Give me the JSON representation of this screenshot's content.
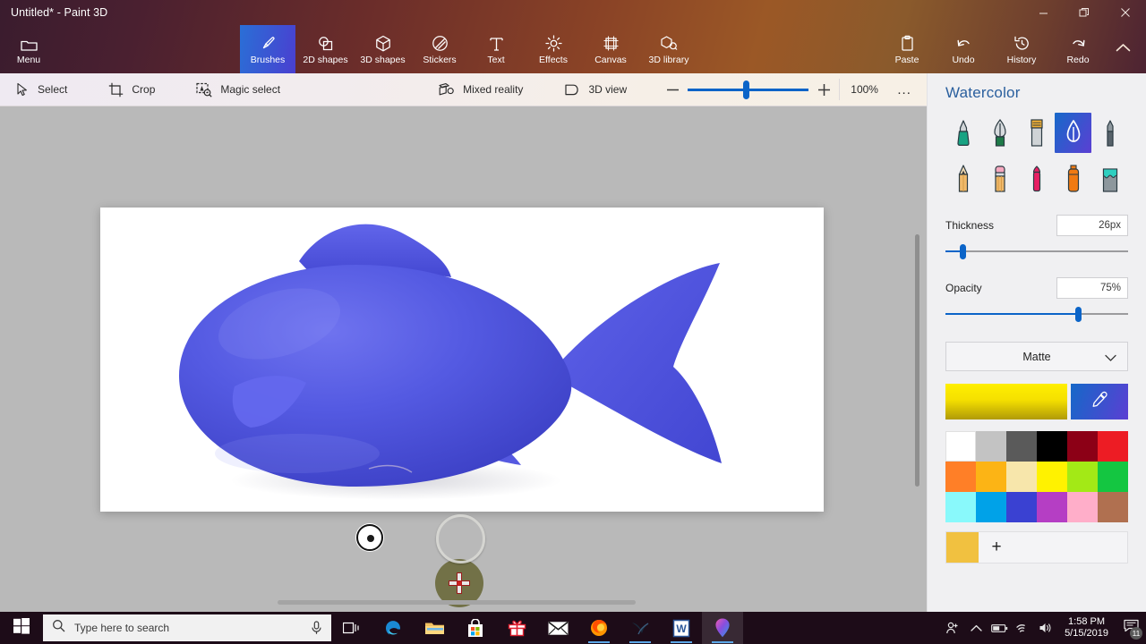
{
  "window": {
    "title": "Untitled* - Paint 3D",
    "minimize_label": "Minimize",
    "restore_label": "Restore",
    "close_label": "Close"
  },
  "ribbon": {
    "menu": {
      "label": "Menu",
      "icon": "folder-icon"
    },
    "tools": [
      {
        "label": "Brushes",
        "icon": "brush-icon",
        "active": true
      },
      {
        "label": "2D shapes",
        "icon": "2d-shapes-icon",
        "active": false
      },
      {
        "label": "3D shapes",
        "icon": "3d-shapes-icon",
        "active": false
      },
      {
        "label": "Stickers",
        "icon": "stickers-icon",
        "active": false
      },
      {
        "label": "Text",
        "icon": "text-icon",
        "active": false
      },
      {
        "label": "Effects",
        "icon": "effects-icon",
        "active": false
      },
      {
        "label": "Canvas",
        "icon": "canvas-icon",
        "active": false
      },
      {
        "label": "3D library",
        "icon": "3d-library-icon",
        "active": false
      }
    ],
    "right_tools": [
      {
        "label": "Paste",
        "icon": "clipboard-icon"
      },
      {
        "label": "Undo",
        "icon": "undo-icon"
      },
      {
        "label": "History",
        "icon": "history-icon"
      },
      {
        "label": "Redo",
        "icon": "redo-icon"
      }
    ],
    "collapse_icon": "chevron-up-icon"
  },
  "toolbar": {
    "select": {
      "label": "Select",
      "icon": "cursor-icon"
    },
    "crop": {
      "label": "Crop",
      "icon": "crop-icon"
    },
    "magic_select": {
      "label": "Magic select",
      "icon": "magic-select-icon"
    },
    "mixed_reality": {
      "label": "Mixed reality",
      "icon": "mixed-reality-icon"
    },
    "view_3d": {
      "label": "3D view",
      "icon": "3d-view-icon"
    },
    "zoom_out_label": "Zoom out",
    "zoom_in_label": "Zoom in",
    "zoom_value": "100%",
    "more_label": "..."
  },
  "sidebar": {
    "title": "Watercolor",
    "brushes": [
      {
        "name": "marker",
        "selected": false
      },
      {
        "name": "calligraphy-pen",
        "selected": false
      },
      {
        "name": "oil-brush",
        "selected": false
      },
      {
        "name": "watercolor",
        "selected": true
      },
      {
        "name": "pixel-pen",
        "selected": false
      },
      {
        "name": "pencil",
        "selected": false
      },
      {
        "name": "eraser",
        "selected": false
      },
      {
        "name": "crayon",
        "selected": false
      },
      {
        "name": "spray-can",
        "selected": false
      },
      {
        "name": "fill",
        "selected": false
      }
    ],
    "thickness": {
      "label": "Thickness",
      "value": "26px",
      "percent": 10
    },
    "opacity": {
      "label": "Opacity",
      "value": "75%",
      "percent": 75
    },
    "material": {
      "value": "Matte",
      "icon": "chevron-down-icon"
    },
    "current_color": "#f5e000",
    "eyedropper_label": "Pick color",
    "palette": [
      "#ffffff",
      "#c3c3c3",
      "#5a5a5a",
      "#000000",
      "#8c0016",
      "#ed1c24",
      "#ff7f27",
      "#fcb415",
      "#f7e6ab",
      "#fff200",
      "#a3e916",
      "#14c641",
      "#89f9fb",
      "#00a2e8",
      "#3a41d2",
      "#b53ec4",
      "#ffaec9",
      "#b07050"
    ],
    "custom_color": "#f1c140",
    "add_color_label": "+"
  },
  "canvas": {
    "artwork_name": "blue-fish-3d-model",
    "fish_color": "#4b4fd6",
    "background": "#ffffff",
    "paint_blob_color": "#56541a",
    "brush_cursor_label": "brush-cursor"
  },
  "taskbar": {
    "start_label": "Start",
    "search_placeholder": "Type here to search",
    "search_icon": "search-icon",
    "mic_icon": "microphone-icon",
    "apps": [
      {
        "name": "task-view-icon",
        "running": false
      },
      {
        "name": "edge-icon",
        "running": false
      },
      {
        "name": "file-explorer-icon",
        "running": false
      },
      {
        "name": "microsoft-store-icon",
        "running": false
      },
      {
        "name": "gift-icon",
        "running": false
      },
      {
        "name": "mail-icon",
        "running": false
      },
      {
        "name": "firefox-icon",
        "running": true
      },
      {
        "name": "x-app-icon",
        "running": true
      },
      {
        "name": "word-icon",
        "running": true
      },
      {
        "name": "paint3d-icon",
        "running": true
      }
    ],
    "tray": [
      {
        "name": "people-icon"
      },
      {
        "name": "show-hidden-icons-icon"
      },
      {
        "name": "battery-icon"
      },
      {
        "name": "wifi-icon"
      },
      {
        "name": "volume-icon"
      }
    ],
    "time": "1:58 PM",
    "date": "5/15/2019",
    "notification_icon": "notifications-icon",
    "notification_count": "11"
  }
}
